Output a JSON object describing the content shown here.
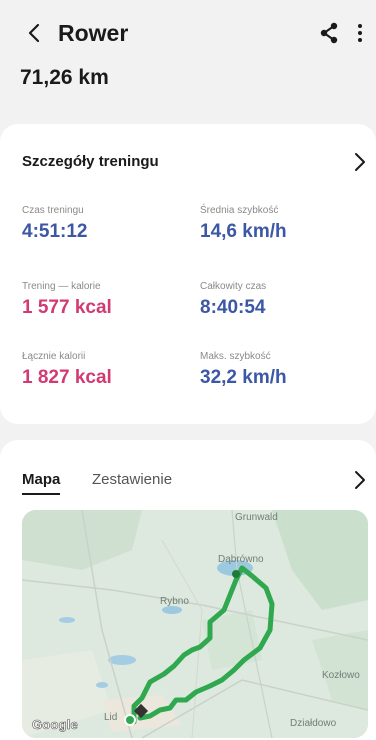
{
  "header": {
    "title": "Rower",
    "distance": "71,26 km"
  },
  "details": {
    "title": "Szczegóły treningu",
    "stats": [
      {
        "label": "Czas treningu",
        "value": "4:51:12",
        "color": "#3b57a6"
      },
      {
        "label": "Średnia szybkość",
        "value": "14,6 km/h",
        "color": "#3b57a6"
      },
      {
        "label": "Trening — kalorie",
        "value": "1 577 kcal",
        "color": "#d13a72"
      },
      {
        "label": "Całkowity czas",
        "value": "8:40:54",
        "color": "#3b57a6"
      },
      {
        "label": "Łącznie kalorii",
        "value": "1 827 kcal",
        "color": "#d13a72"
      },
      {
        "label": "Maks. szybkość",
        "value": "32,2 km/h",
        "color": "#3b57a6"
      }
    ]
  },
  "map_card": {
    "tabs": [
      {
        "label": "Mapa",
        "active": true
      },
      {
        "label": "Zestawienie",
        "active": false
      }
    ],
    "map_labels": {
      "top": "Grunwald",
      "center": "Dąbrówno",
      "middle": "Rybno",
      "right": "Kozłowo",
      "bottom_right": "Działdowo",
      "bottom_left": "Lid"
    },
    "attribution": "Google",
    "route_color": "#2fa84f"
  },
  "icons": {
    "back": "chevron-left-icon",
    "share": "share-icon",
    "more": "more-vertical-icon",
    "details_more": "chevron-right-icon",
    "map_more": "chevron-right-icon"
  }
}
